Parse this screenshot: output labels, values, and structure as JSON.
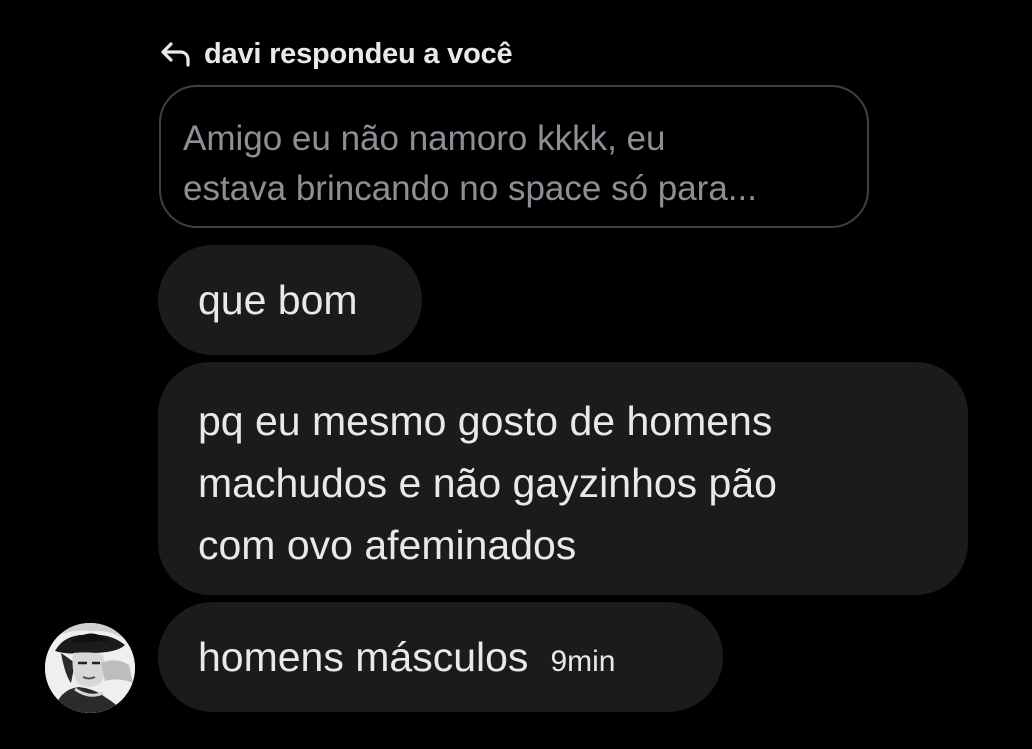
{
  "reply_header": {
    "icon": "reply-arrow-icon",
    "text": "davi respondeu a você"
  },
  "quoted_message": {
    "line1": "Amigo eu não namoro kkkk, eu",
    "line2": "estava brincando no space só para..."
  },
  "messages": [
    {
      "lines": [
        "que bom"
      ]
    },
    {
      "lines": [
        "pq eu mesmo gosto de homens",
        "machudos e não gayzinhos pão",
        "com ovo afeminados"
      ]
    },
    {
      "lines": [
        "homens másculos"
      ],
      "time": "9min"
    }
  ],
  "colors": {
    "background": "#000000",
    "bubble": "#1a1b1d",
    "quote_border": "#3e4144",
    "quote_text": "#8b9096",
    "text": "#e7e9ea"
  },
  "avatar": {
    "icon": "user-avatar-photo"
  }
}
